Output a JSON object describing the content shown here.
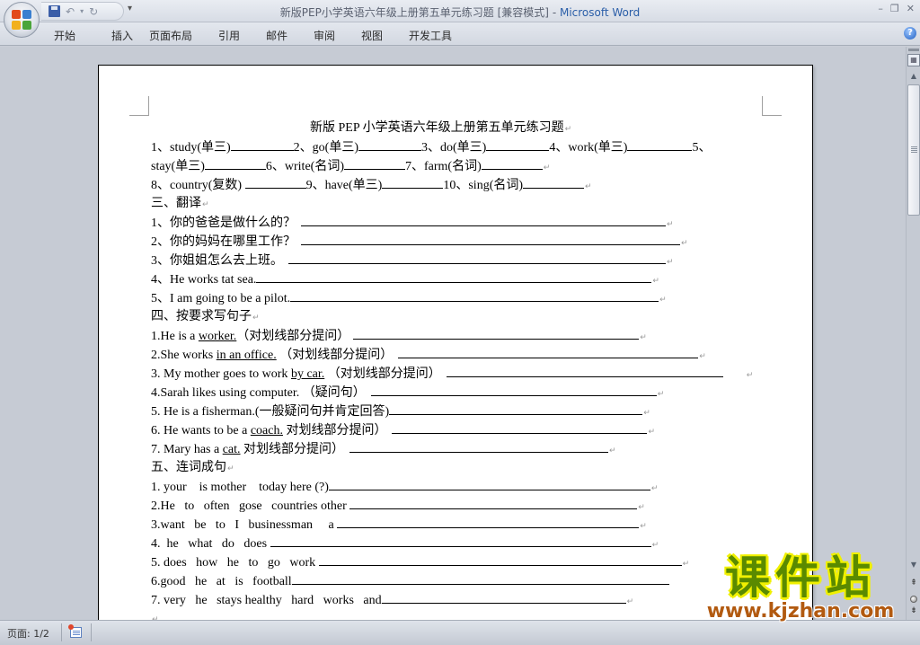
{
  "window": {
    "title_doc": "新版PEP小学英语六年级上册第五单元练习题 [兼容模式]",
    "title_sep": " - ",
    "title_app": "Microsoft Word",
    "controls": {
      "minimize": "–",
      "restore": "❐",
      "close": "✕"
    }
  },
  "quick_access": {
    "save": "save-icon",
    "undo": "↶",
    "undo_drop": "▾",
    "redo": "↻",
    "customize": "▾"
  },
  "ribbon": {
    "tabs": [
      "开始",
      "插入",
      "页面布局",
      "引用",
      "邮件",
      "审阅",
      "视图",
      "开发工具"
    ],
    "help": "?"
  },
  "document": {
    "title": "新版 PEP 小学英语六年级上册第五单元练习题",
    "section1": {
      "line1": [
        "1、study(单三)",
        "2、go(单三)",
        "3、do(单三)",
        "4、work(单三)",
        "5、"
      ],
      "line2": [
        "stay(单三)",
        "6、write(名词)",
        "7、farm(名词)"
      ],
      "line3": [
        "8、country(复数) ",
        "9、have(单三)",
        "10、sing(名词)"
      ]
    },
    "section3": {
      "heading": "三、翻译",
      "items": [
        "1、你的爸爸是做什么的？",
        "2、你的妈妈在哪里工作？",
        "3、你姐姐怎么去上班。",
        "4、He works tat sea.",
        "5、I am going to be a pilot."
      ]
    },
    "section4": {
      "heading": "四、按要求写句子",
      "items": [
        {
          "pre": "1.He is a ",
          "u": "worker.",
          "post": "（对划线部分提问）"
        },
        {
          "pre": "2.She works ",
          "u": "in an office.",
          "post": " （对划线部分提问）"
        },
        {
          "pre": "3. My mother goes to work ",
          "u": "by car.",
          "post": " （对划线部分提问）"
        },
        {
          "pre": "4.Sarah likes  using computer.  （疑问句）",
          "u": "",
          "post": ""
        },
        {
          "pre": "5. He is a fisherman.(一般疑问句并肯定回答)",
          "u": "",
          "post": ""
        },
        {
          "pre": "6. He wants to be a ",
          "u": "coach.",
          "post": " 对划线部分提问）"
        },
        {
          "pre": "7. Mary has a ",
          "u": "cat.",
          "post": " 对划线部分提问）"
        }
      ]
    },
    "section5": {
      "heading": "五、连词成句",
      "items": [
        "1. your    is mother    today here (?)",
        "2.He   to   often   gose   countries other ",
        "3.want   be   to   I   businessman     a ",
        "4.  he   what   do   does ",
        "5. does   how   he   to   go   work ",
        "6.good   he   at   is   football",
        "7. very   he   stays healthy   hard   works   and"
      ]
    },
    "paragraph_mark": "↵"
  },
  "statusbar": {
    "page_label": "页面: 1/2"
  },
  "watermark": {
    "cn": "课件站",
    "url": "www.kjzhan.com"
  }
}
